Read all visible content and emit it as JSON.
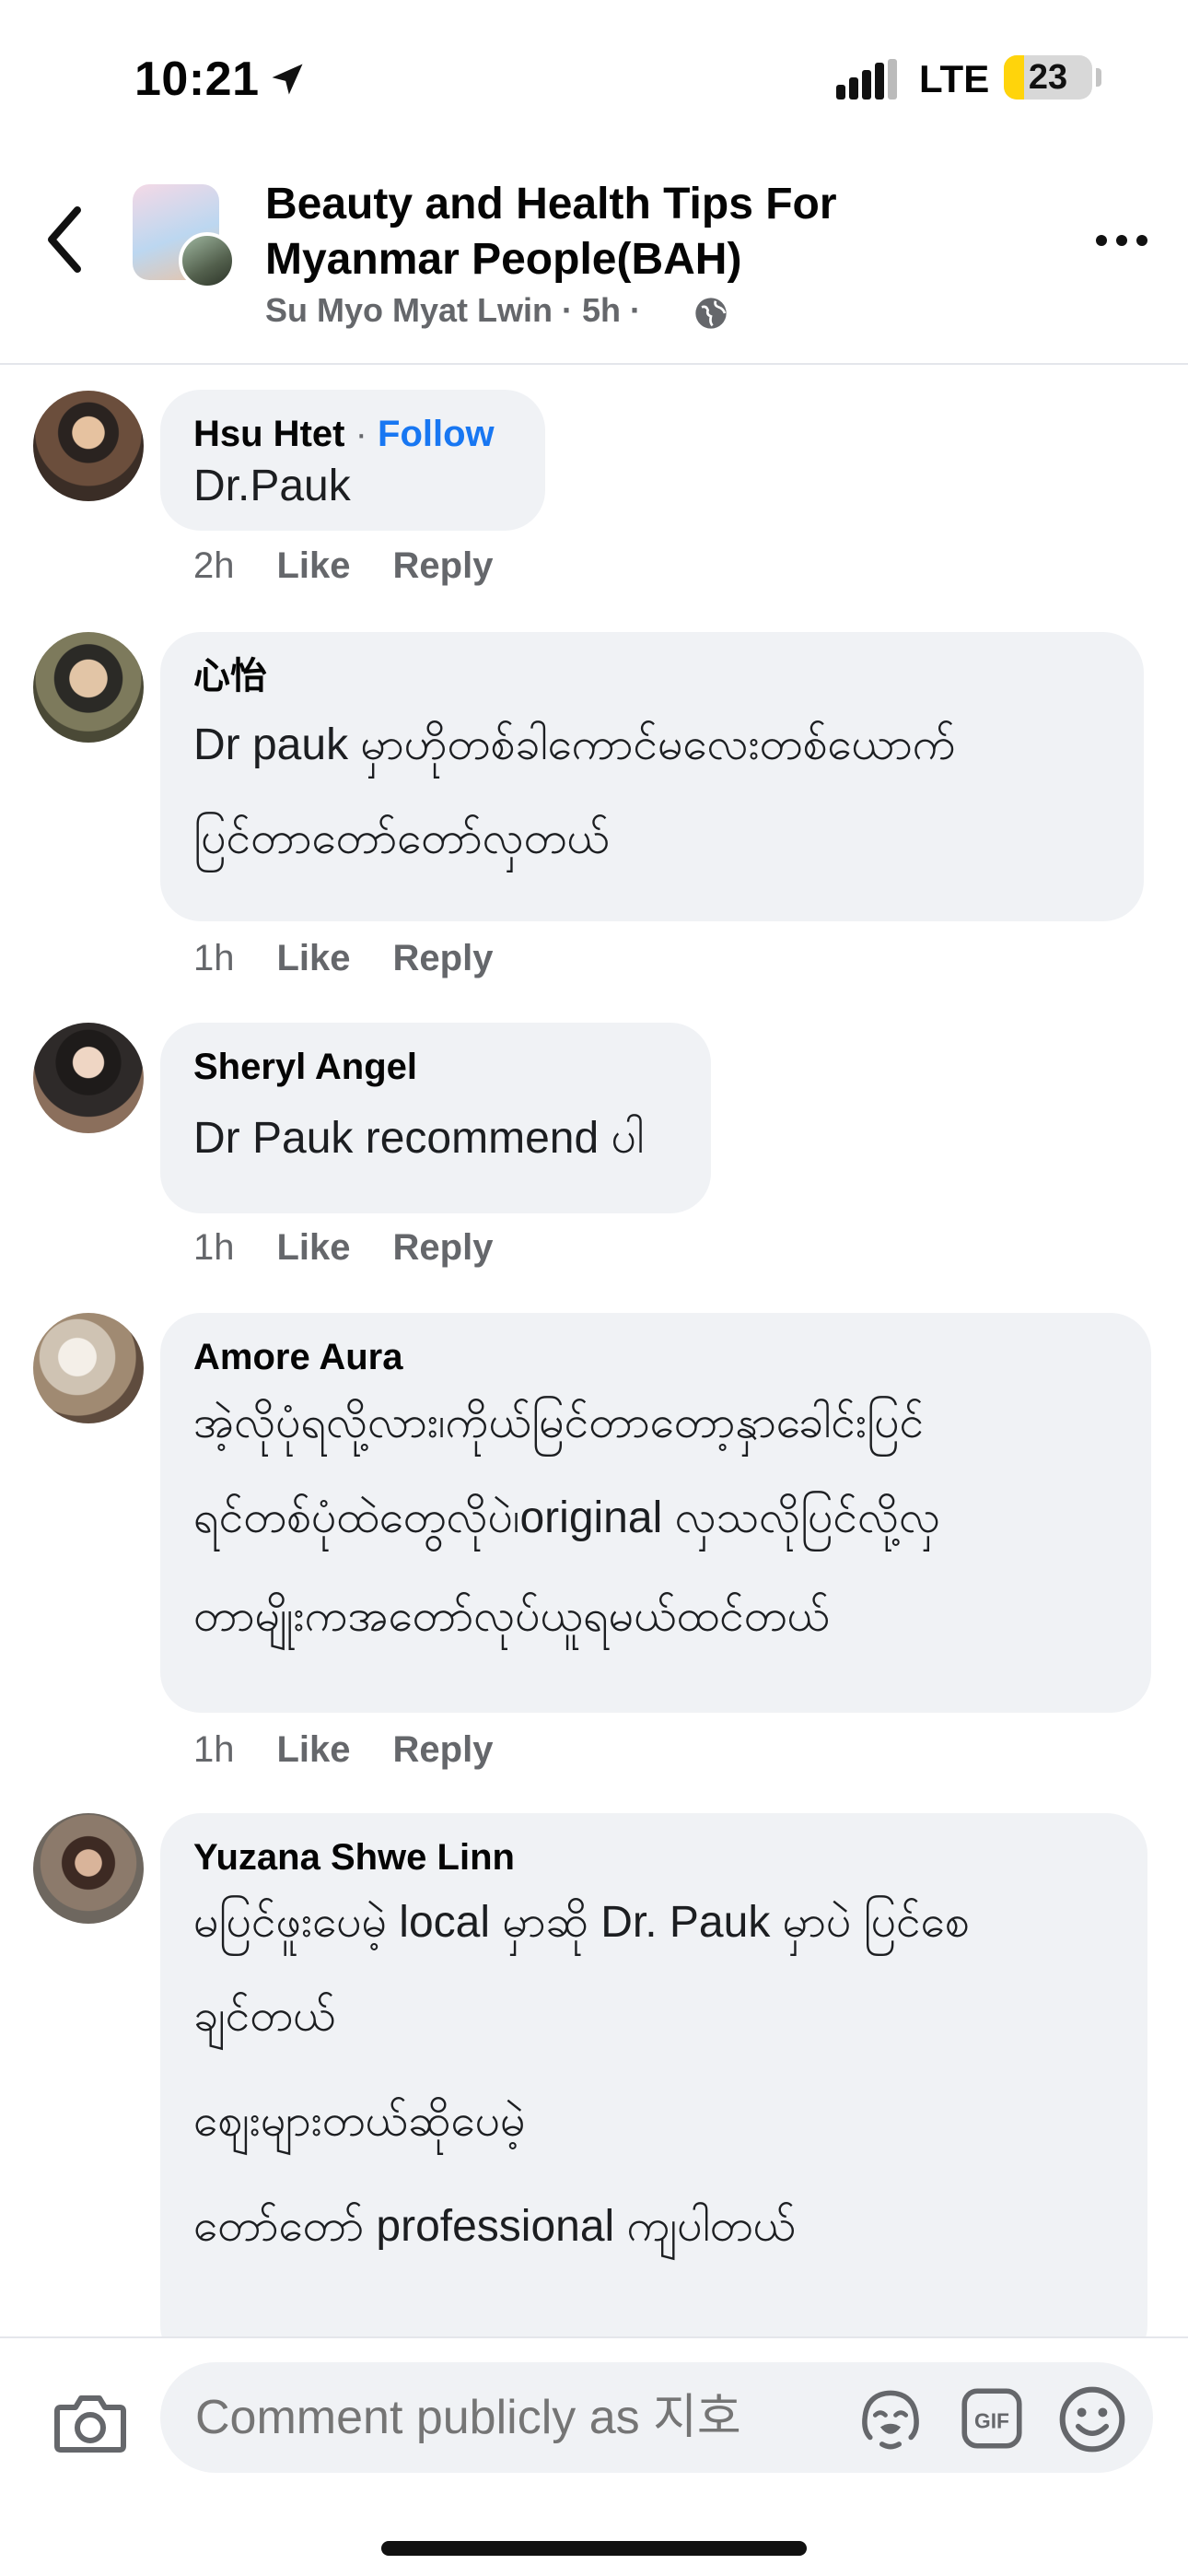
{
  "status_bar": {
    "time": "10:21",
    "network": "LTE",
    "battery": "23",
    "battery_level": 0.23,
    "battery_color": "#ffd40b"
  },
  "header": {
    "title": "Beauty and Health Tips For Myanmar People(BAH)",
    "subtitle": "Su Myo Myat Lwin · 5h ·"
  },
  "colors": {
    "follow_blue": "#1877f2",
    "bubble_gray": "#f0f2f5",
    "meta_gray": "#65676b"
  },
  "comments": [
    {
      "author": "Hsu Htet",
      "follow_label": "Follow",
      "text": "Dr.Pauk",
      "time": "2h",
      "like": "Like",
      "reply": "Reply"
    },
    {
      "author": "心怡",
      "line1": "Dr pauk မှာဟိုတစ်ခါကောင်မလေးတစ်ယောက်",
      "line2": "ပြင်တာတော်တော်လှတယ်",
      "time": "1h",
      "like": "Like",
      "reply": "Reply"
    },
    {
      "author": "Sheryl Angel",
      "text": "Dr Pauk recommend ပါ",
      "time": "1h",
      "like": "Like",
      "reply": "Reply"
    },
    {
      "author": "Amore Aura",
      "line1": "အဲ့လိုပုံရလို့လား၊ကိုယ်မြင်တာတော့နှာခေါင်းပြင်",
      "line2": "ရင်တစ်ပုံထဲတွေလိုပဲ၊original လှသလိုပြင်လို့လှ",
      "line3": "တာမျိုးကအတော်လုပ်ယူရမယ်ထင်တယ်",
      "time": "1h",
      "like": "Like",
      "reply": "Reply"
    },
    {
      "author": "Yuzana Shwe Linn",
      "line1": "မပြင်ဖူးပေမဲ့ local မှာဆို Dr. Pauk မှာပဲ ပြင်စေ",
      "line2": "ချင်တယ်",
      "line3": "စျေးများတယ်ဆိုပေမဲ့",
      "line4": "တော်တော် professional ကျပါတယ်"
    }
  ],
  "composer": {
    "placeholder": "Comment publicly as 지호",
    "gif_label": "GIF"
  }
}
